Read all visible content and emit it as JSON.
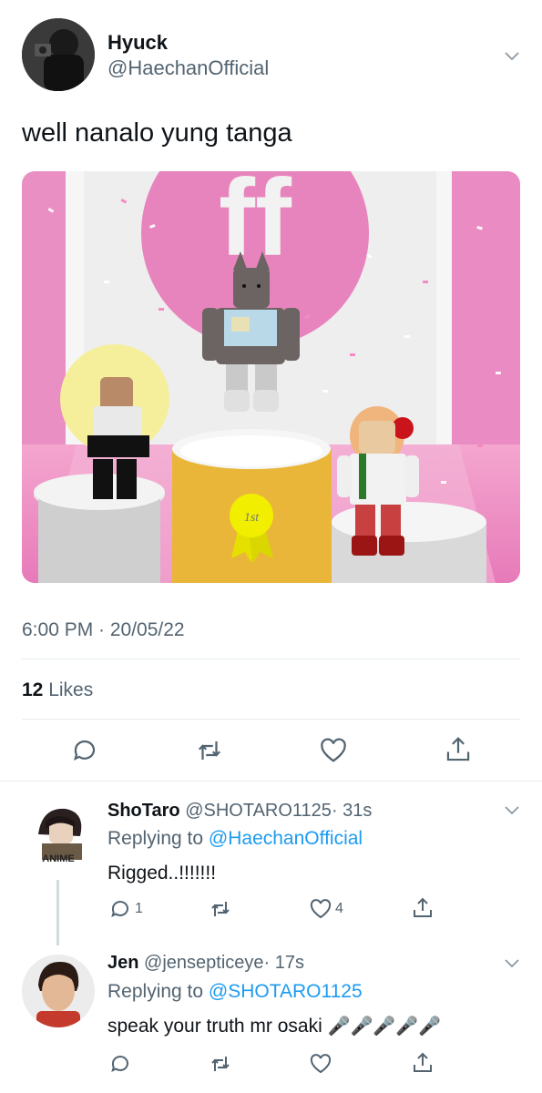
{
  "tweet": {
    "author_name": "Hyuck",
    "author_handle": "@HaechanOfficial",
    "text": "well nanalo yung tanga",
    "image": {
      "logo_text": "ff",
      "badge_text": "1st"
    },
    "timestamp": "6:00 PM · 20/05/22",
    "likes_count": "12",
    "likes_label": "Likes"
  },
  "replies": [
    {
      "name": "ShoTaro",
      "handle": "@SHOTARO1125",
      "time": "· 31s",
      "replying_prefix": "Replying to",
      "replying_to": "@HaechanOfficial",
      "text": "Rigged..!!!!!!!",
      "reply_count": "1",
      "like_count": "4",
      "avatar_text": "ANIME"
    },
    {
      "name": "Jen",
      "handle": "@jensepticeye",
      "time": "· 17s",
      "replying_prefix": "Replying to",
      "replying_to": "@SHOTARO1125",
      "text": "speak your truth mr osaki",
      "emoji": "🎤🎤🎤🎤🎤"
    }
  ],
  "colors": {
    "link": "#1d9bf0",
    "secondary_text": "#536471",
    "divider": "#e6ecf0"
  }
}
